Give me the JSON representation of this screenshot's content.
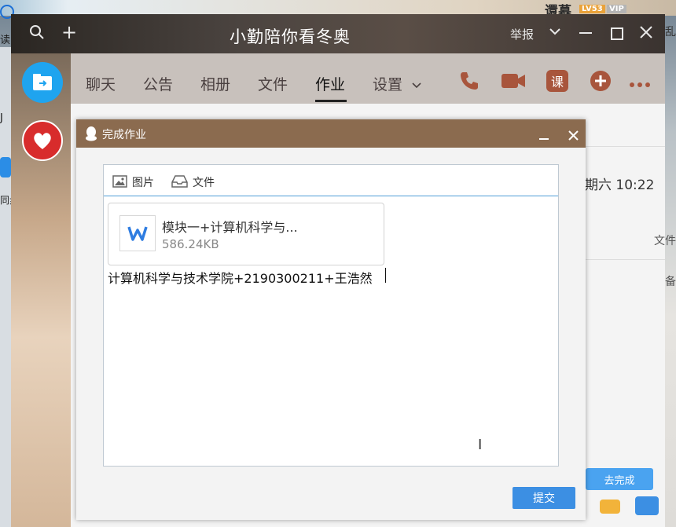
{
  "window": {
    "title": "小勤陪你看冬奥",
    "report": "举报"
  },
  "nav": {
    "tabs": [
      {
        "label": "聊天"
      },
      {
        "label": "公告"
      },
      {
        "label": "相册"
      },
      {
        "label": "文件"
      },
      {
        "label": "作业"
      },
      {
        "label": "设置"
      }
    ],
    "icons": {
      "course": "课"
    }
  },
  "background": {
    "timestamp": "期六 10:22",
    "done_button": "去完成",
    "right_partial_1": "文件",
    "right_partial_2": "备"
  },
  "desktop": {
    "left_labels": [
      "读",
      "J",
      "同步"
    ],
    "top_user": "還慕",
    "level_badge": "LV53",
    "vip_badge": "VIP",
    "top_right_partial": "乱"
  },
  "dialog": {
    "title": "完成作业",
    "toolbar": {
      "image_label": "图片",
      "file_label": "文件"
    },
    "attachment": {
      "name": "模块一+计算机科学与...",
      "size": "586.24KB"
    },
    "message": "计算机科学与技术学院+2190300211+王浩然",
    "submit_label": "提交"
  },
  "colors": {
    "dialog_title_bar": "#8b6b4f",
    "submit_button": "#3c8fe3",
    "editor_border_active": "#4f9ed8",
    "nav_course_icon": "#a8553c"
  }
}
